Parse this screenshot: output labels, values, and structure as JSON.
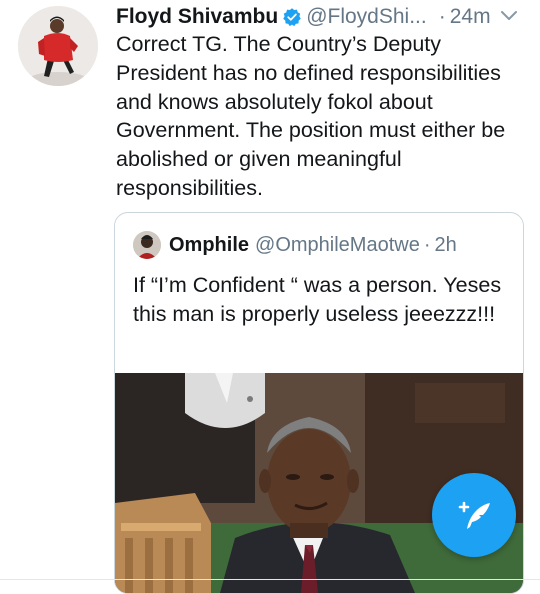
{
  "tweet": {
    "author_name": "Floyd Shivambu",
    "author_handle": "@FloydShi...",
    "separator": "·",
    "time": "24m",
    "verified": true,
    "text": "Correct TG. The Country’s Deputy President has no defined responsibilities and knows absolutely fokol about Government. The position must either be abolished or given meaningful responsibilities."
  },
  "quoted_tweet": {
    "author_name": "Omphile",
    "author_handle": "@OmphileMaotwe",
    "separator": "·",
    "time": "2h",
    "text": "If “I’m Confident “ was a person. Yeses this man is properly useless jeeezzz!!!"
  },
  "icons": {
    "verified": "verified-badge-icon",
    "caret": "chevron-down-icon",
    "compose": "compose-tweet-icon"
  },
  "colors": {
    "accent": "#1da1f2",
    "text": "#14171a",
    "secondary": "#657786",
    "border": "#ccd6dd"
  }
}
